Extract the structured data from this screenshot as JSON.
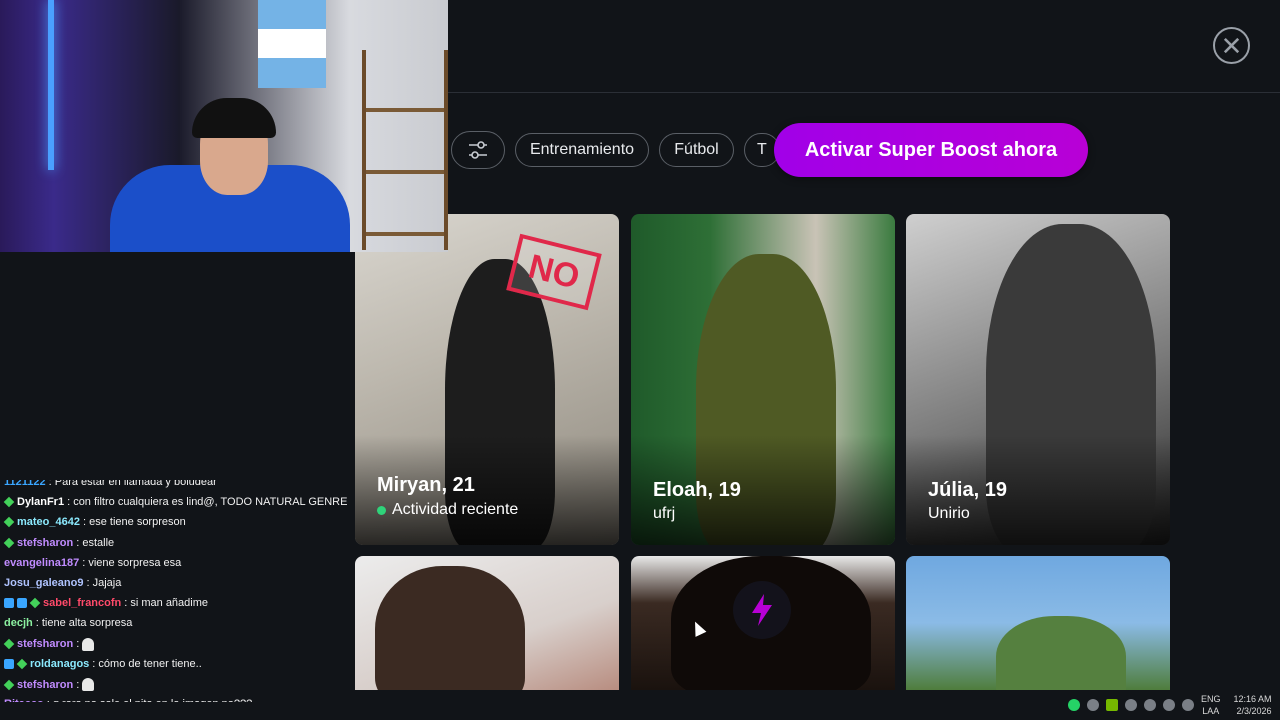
{
  "app": {
    "close_label": "✕",
    "chips": [
      "Entrenamiento",
      "Fútbol",
      "T"
    ],
    "boost_label": "Activar Super Boost ahora",
    "colors": {
      "boost": "#a100e8",
      "online": "#2fd37a",
      "stamp": "#e0284a"
    }
  },
  "cards": [
    {
      "name": "Miryan, 21",
      "sub": "Actividad reciente",
      "stamp": "NO"
    },
    {
      "name": "Eloah, 19",
      "sub": "ufrj"
    },
    {
      "name": "Júlia, 19",
      "sub": "Unirio"
    }
  ],
  "chat": [
    {
      "user": "1121122",
      "text": ": Para estar en llamada y boludear",
      "user_color": "#3aa6ff"
    },
    {
      "user": "DylanFr1",
      "text": ": con filtro cualquiera es lind@, TODO NATURAL GENRE",
      "user_color": "#ffffff",
      "badge": "green"
    },
    {
      "user": "mateo_4642",
      "text": ": ese tiene sorpreson",
      "user_color": "#8be9fd",
      "badge": "green"
    },
    {
      "user": "stefsharon",
      "text": ": estalle",
      "user_color": "#c18cff",
      "badge": "green"
    },
    {
      "user": "evangelina187",
      "text": ": viene sorpresa esa",
      "user_color": "#c18cff"
    },
    {
      "user": "Josu_galeano9",
      "text": ": Jajaja",
      "user_color": "#b0c4ff"
    },
    {
      "user": "sabel_francofn",
      "text": ": si man añadime",
      "user_color": "#ff4a6a",
      "badge": "multi"
    },
    {
      "user": "decjh",
      "text": ": tiene alta sorpresa",
      "user_color": "#8bf0a0"
    },
    {
      "user": "stefsharon",
      "text": ":",
      "user_color": "#c18cff",
      "badge": "green",
      "ghost": true
    },
    {
      "user": "roldanagos",
      "text": ": cómo de tener tiene..",
      "user_color": "#8be9fd",
      "badge": "blue-green"
    },
    {
      "user": "stefsharon",
      "text": ":",
      "user_color": "#c18cff",
      "badge": "green",
      "ghost": true
    },
    {
      "user": "Ritacco",
      "text": ": q raro no sale el pito en la imagen no???",
      "user_color": "#c18cff"
    }
  ],
  "taskbar": {
    "lang_1": "ENG",
    "lang_2": "LAA",
    "time": "12:16 AM",
    "date": "2/3/2026"
  }
}
